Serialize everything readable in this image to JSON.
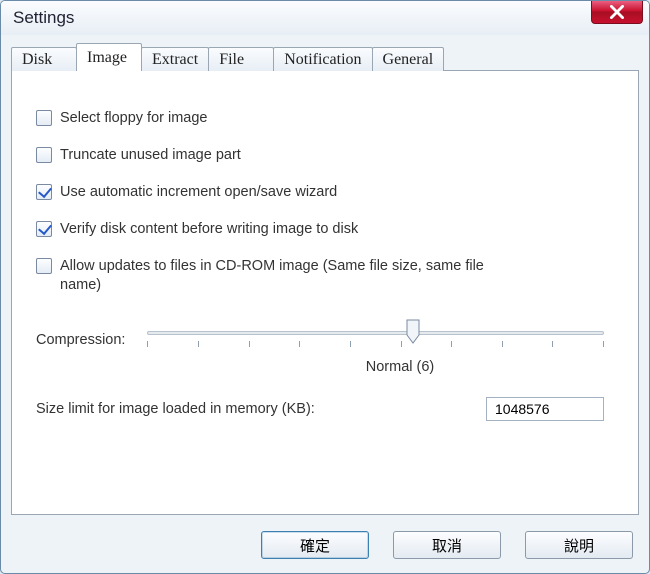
{
  "window": {
    "title": "Settings"
  },
  "tabs": {
    "disk": "Disk",
    "image": "Image",
    "extract": "Extract",
    "file": "File",
    "notification": "Notification",
    "general": "General",
    "active": "image"
  },
  "options": {
    "select_floppy": {
      "label": "Select floppy for image",
      "checked": false
    },
    "truncate": {
      "label": "Truncate unused image part",
      "checked": false
    },
    "auto_increment": {
      "label": "Use automatic increment open/save wizard",
      "checked": true
    },
    "verify": {
      "label": "Verify disk content before writing image to disk",
      "checked": true
    },
    "allow_updates": {
      "label": "Allow updates to files in CD-ROM image (Same file size, same file name)",
      "checked": false
    }
  },
  "compression": {
    "label": "Compression:",
    "value_label": "Normal (6)",
    "value": 6,
    "min": 0,
    "max": 9
  },
  "memory": {
    "label": "Size limit for image loaded in memory (KB):",
    "value": "1048576"
  },
  "buttons": {
    "ok": "確定",
    "cancel": "取消",
    "help": "說明"
  }
}
